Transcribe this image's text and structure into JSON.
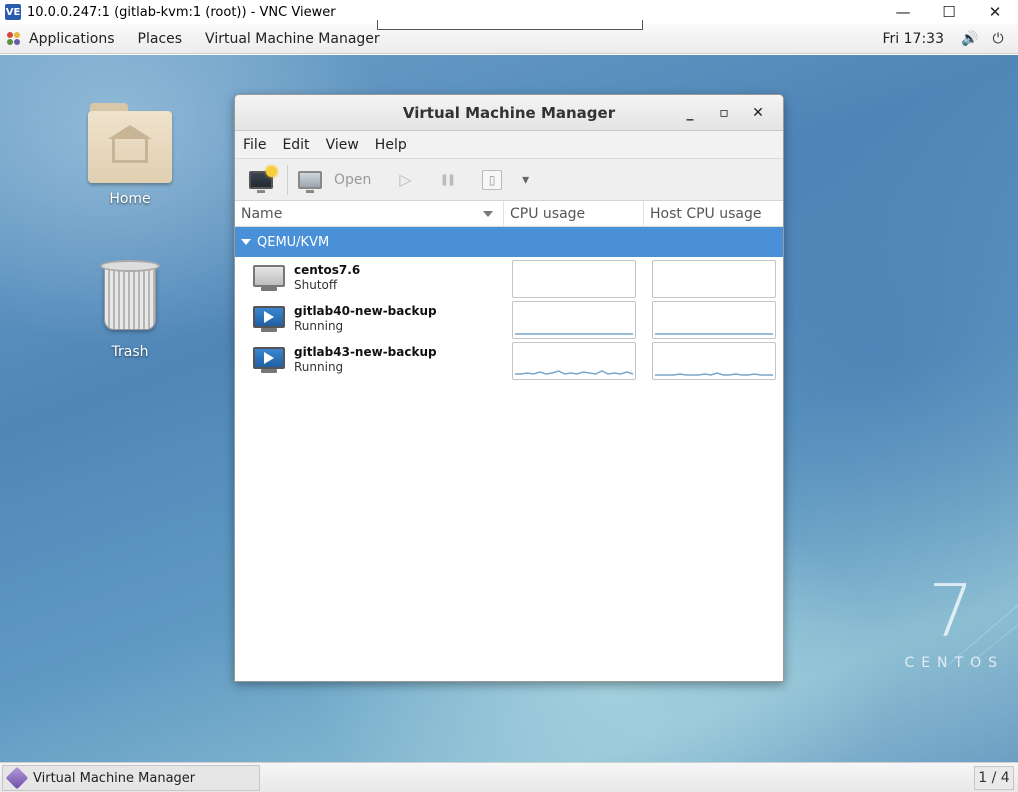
{
  "vnc": {
    "title": "10.0.0.247:1 (gitlab-kvm:1 (root)) - VNC Viewer",
    "logo": "VE",
    "minimize": "—",
    "maximize": "☐",
    "close": "✕"
  },
  "topbar": {
    "applications": "Applications",
    "places": "Places",
    "app_menu": "Virtual Machine Manager",
    "clock": "Fri 17:33",
    "volume_glyph": "🔊",
    "power_glyph": "⏻"
  },
  "desktop": {
    "icons": [
      {
        "label": "Home",
        "icon": "home-folder-icon"
      },
      {
        "label": "Trash",
        "icon": "trash-icon"
      }
    ],
    "branding": {
      "number": "7",
      "text": "CENTOS"
    }
  },
  "vmm": {
    "title": "Virtual Machine Manager",
    "window_buttons": {
      "minimize": "_",
      "maximize": "▫",
      "close": "✕"
    },
    "menus": [
      "File",
      "Edit",
      "View",
      "Help"
    ],
    "toolbar": {
      "open_label": "Open",
      "run_glyph": "▷",
      "pause_glyph": "❚❚",
      "shutdown_glyph": "▯",
      "dropdown_glyph": "▾"
    },
    "columns": [
      "Name",
      "CPU usage",
      "Host CPU usage"
    ],
    "group": "QEMU/KVM",
    "vms": [
      {
        "name": "centos7.6",
        "status": "Shutoff",
        "running": false,
        "cpu_trace": [],
        "host_trace": []
      },
      {
        "name": "gitlab40-new-backup",
        "status": "Running",
        "running": true,
        "cpu_trace": [
          2,
          2,
          2,
          2,
          2,
          2,
          2,
          2,
          2,
          2,
          2,
          2,
          2,
          2,
          2,
          2,
          2,
          2,
          2,
          2
        ],
        "host_trace": [
          2,
          2,
          2,
          2,
          2,
          2,
          2,
          2,
          2,
          2,
          2,
          2,
          2,
          2,
          2,
          2,
          2,
          2,
          2,
          2
        ]
      },
      {
        "name": "gitlab43-new-backup",
        "status": "Running",
        "running": true,
        "cpu_trace": [
          3,
          3,
          4,
          3,
          5,
          3,
          4,
          6,
          3,
          4,
          3,
          5,
          4,
          3,
          6,
          3,
          4,
          3,
          5,
          3
        ],
        "host_trace": [
          2,
          2,
          2,
          2,
          3,
          2,
          2,
          2,
          3,
          2,
          4,
          2,
          2,
          3,
          2,
          2,
          3,
          2,
          2,
          2
        ]
      }
    ]
  },
  "taskbar": {
    "task_label": "Virtual Machine Manager",
    "workspace": "1 / 4"
  },
  "colors": {
    "selection": "#4a90d9",
    "graph_line": "#7aa6c8"
  }
}
